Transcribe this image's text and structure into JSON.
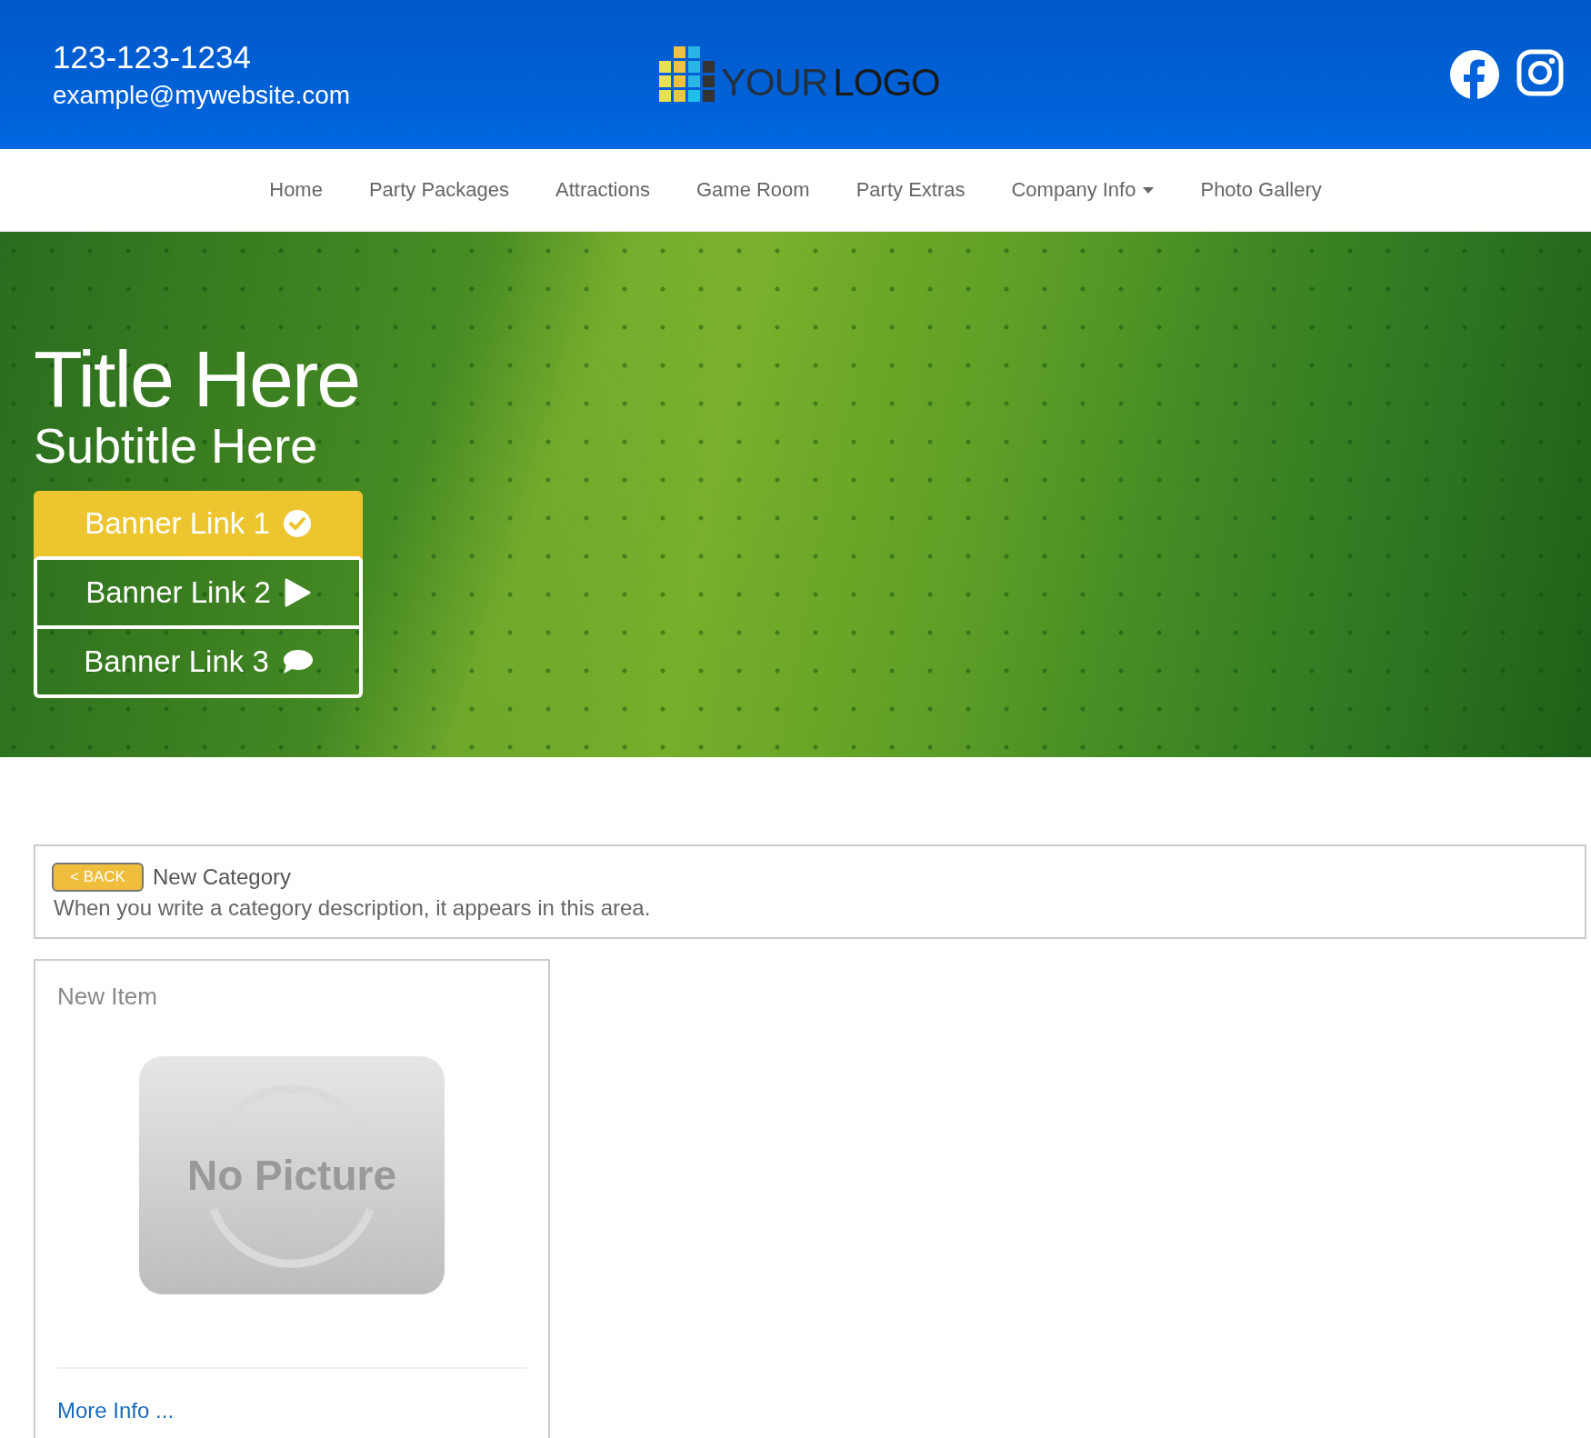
{
  "header": {
    "phone": "123-123-1234",
    "email": "example@mywebsite.com",
    "logo": {
      "word_1": "YOUR",
      "word_2": "LOGO"
    }
  },
  "nav": [
    {
      "label": "Home",
      "has_dropdown": false
    },
    {
      "label": "Party Packages",
      "has_dropdown": false
    },
    {
      "label": "Attractions",
      "has_dropdown": false
    },
    {
      "label": "Game Room",
      "has_dropdown": false
    },
    {
      "label": "Party Extras",
      "has_dropdown": false
    },
    {
      "label": "Company Info",
      "has_dropdown": true
    },
    {
      "label": "Photo Gallery",
      "has_dropdown": false
    }
  ],
  "banner": {
    "title": "Title Here",
    "subtitle": "Subtitle Here",
    "links": [
      {
        "label": "Banner Link 1",
        "kind": "check",
        "selected": true
      },
      {
        "label": "Banner Link 2",
        "kind": "play",
        "selected": false
      },
      {
        "label": "Banner Link 3",
        "kind": "chat",
        "selected": false
      }
    ]
  },
  "category": {
    "back_button": "< BACK",
    "title": "New Category",
    "description": "When you write a category description, it appears in this area."
  },
  "items": [
    {
      "title": "New Item",
      "image_placeholder": "No Picture",
      "link": "More Info ..."
    }
  ]
}
